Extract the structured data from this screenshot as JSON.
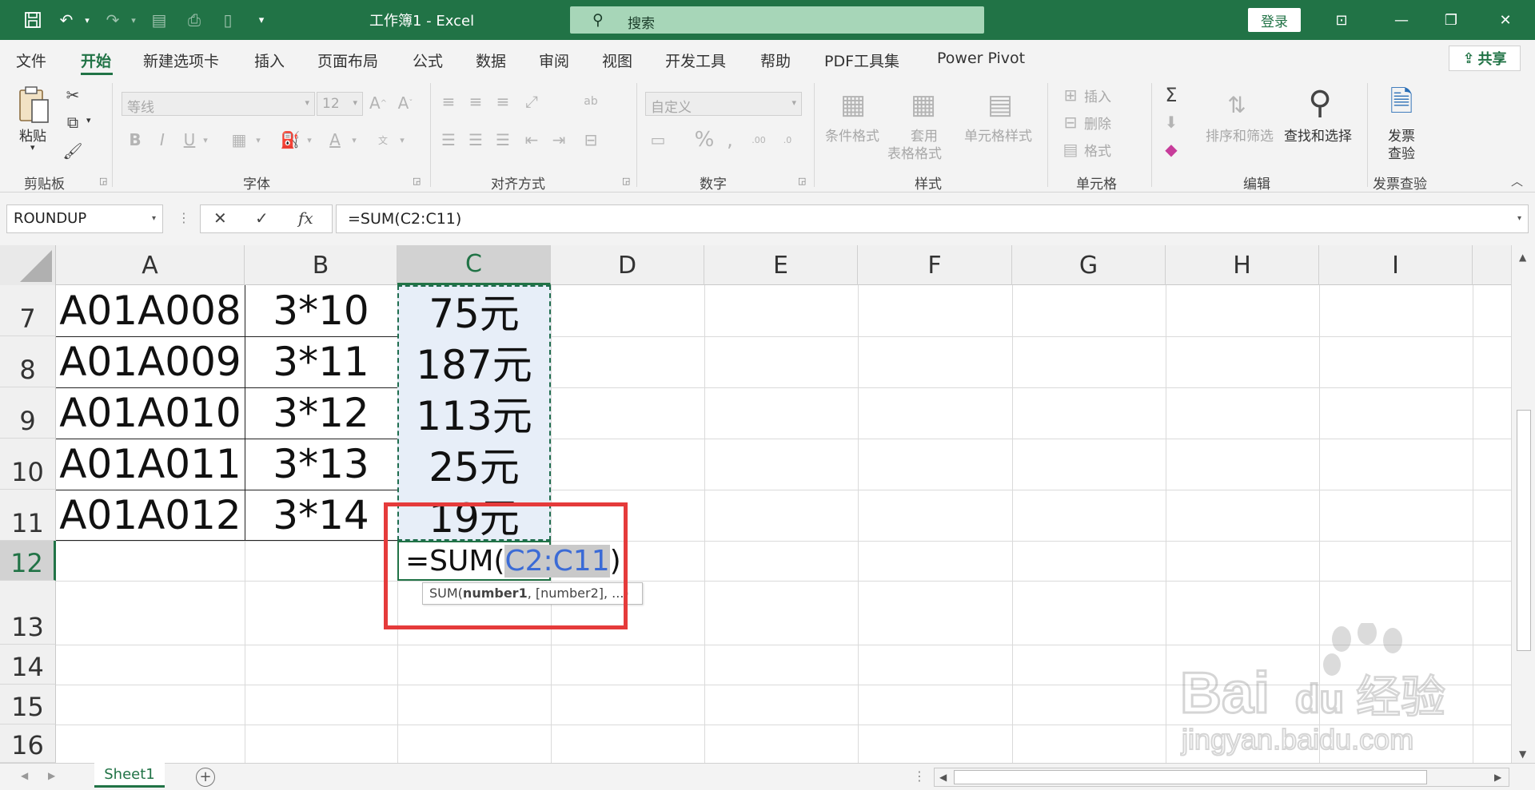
{
  "titlebar": {
    "title": "工作簿1  -  Excel",
    "search_placeholder": "搜索",
    "login_label": "登录",
    "accent_color": "#217346"
  },
  "menu": {
    "tabs": [
      "文件",
      "开始",
      "新建选项卡",
      "插入",
      "页面布局",
      "公式",
      "数据",
      "审阅",
      "视图",
      "开发工具",
      "帮助",
      "PDF工具集",
      "Power Pivot"
    ],
    "active_tab": "开始",
    "share_label": "共享"
  },
  "ribbon": {
    "clipboard": {
      "paste_label": "粘贴",
      "group_label": "剪贴板"
    },
    "font": {
      "font_name": "等线",
      "font_size": "12",
      "group_label": "字体"
    },
    "alignment": {
      "group_label": "对齐方式"
    },
    "number": {
      "format": "自定义",
      "group_label": "数字"
    },
    "styles": {
      "conditional_label": "条件格式",
      "table_label_1": "套用",
      "table_label_2": "表格格式",
      "cell_style_label": "单元格样式",
      "group_label": "样式"
    },
    "cells": {
      "insert_label": "插入",
      "delete_label": "删除",
      "format_label": "格式",
      "group_label": "单元格"
    },
    "editing": {
      "sort_label": "排序和筛选",
      "find_label": "查找和选择",
      "group_label": "编辑"
    },
    "invoice": {
      "label_1": "发票",
      "label_2": "查验",
      "group_label": "发票查验"
    }
  },
  "formula_bar": {
    "name_box": "ROUNDUP",
    "formula": "=SUM(C2:C11)"
  },
  "grid": {
    "columns": [
      "A",
      "B",
      "C",
      "D",
      "E",
      "F",
      "G",
      "H",
      "I"
    ],
    "selected_column": "C",
    "rows": [
      {
        "num": "7",
        "a": "A01A008",
        "b": "3*10",
        "c": "75元"
      },
      {
        "num": "8",
        "a": "A01A009",
        "b": "3*11",
        "c": "187元"
      },
      {
        "num": "9",
        "a": "A01A010",
        "b": "3*12",
        "c": "113元"
      },
      {
        "num": "10",
        "a": "A01A011",
        "b": "3*13",
        "c": "25元"
      },
      {
        "num": "11",
        "a": "A01A012",
        "b": "3*14",
        "c": "19元"
      }
    ],
    "empty_rows": [
      "12",
      "13",
      "14",
      "15",
      "16"
    ],
    "active_row": "12",
    "edit_prefix": "=SUM(",
    "edit_ref": "C2:C11",
    "edit_suffix": ")",
    "tooltip_func": "SUM(",
    "tooltip_arg1": "number1",
    "tooltip_rest": ", [number2], ...)"
  },
  "sheets": {
    "tabs": [
      "Sheet1"
    ],
    "active": "Sheet1"
  },
  "watermark": {
    "text_1": "Bai",
    "text_2": "du",
    "text_3": "经验",
    "text_4": "jingyan.baidu.com"
  }
}
